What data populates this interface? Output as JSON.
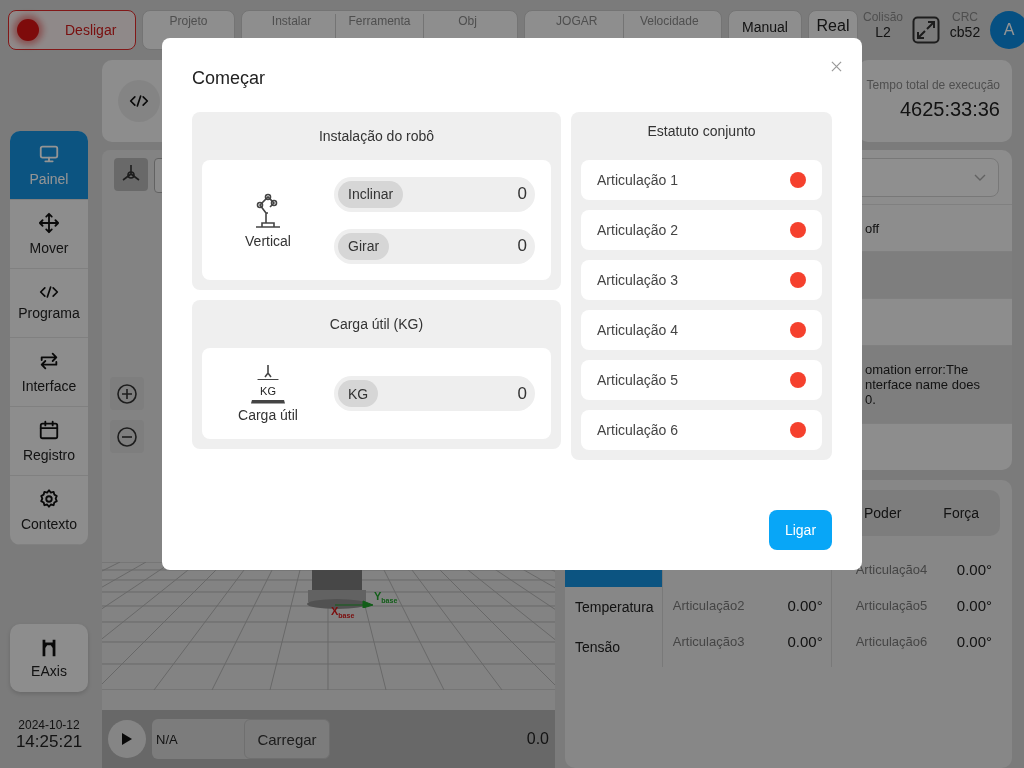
{
  "top_bar": {
    "power_button": {
      "label": "Desligar"
    },
    "groups": [
      [
        {
          "title": "Projeto"
        }
      ],
      [
        {
          "title": "Instalar"
        },
        {
          "title": "Ferramenta"
        },
        {
          "title": "Obj"
        }
      ],
      [
        {
          "title": "JOGAR"
        },
        {
          "title": "Velocidade"
        }
      ]
    ],
    "mode_buttons": [
      "Manual",
      "Real"
    ],
    "collision": {
      "title": "Colisão",
      "value": "L2"
    },
    "crc": {
      "title": "CRC",
      "value": "cb52"
    },
    "avatar": "A"
  },
  "sidebar": {
    "items": [
      {
        "label": "Painel",
        "selected": true
      },
      {
        "label": "Mover",
        "selected": false
      },
      {
        "label": "Programa",
        "selected": false
      },
      {
        "label": "Interface",
        "selected": false
      },
      {
        "label": "Registro",
        "selected": false
      },
      {
        "label": "Contexto",
        "selected": false
      }
    ],
    "extra_button": "EAxis",
    "date": "2024-10-12",
    "time": "14:25:21"
  },
  "runtime": {
    "label": "Tempo total de execução",
    "value": "4625:33:36"
  },
  "viewport": {
    "axis_labels": [
      "X$_{base}$",
      "Y$_{base}$"
    ]
  },
  "playbar": {
    "program": "N/A",
    "load_button": "Carregar",
    "reading": "0.0"
  },
  "status_panel": {
    "rows": [
      {
        "kind": "text",
        "shaded": false,
        "lines": [
          "off"
        ]
      },
      {
        "kind": "blank",
        "shaded": true
      },
      {
        "kind": "blank",
        "shaded": false
      },
      {
        "kind": "text",
        "shaded": true,
        "lines": [
          "omation error:The",
          "nterface name does",
          "0."
        ]
      },
      {
        "kind": "blank",
        "shaded": false
      }
    ]
  },
  "joint_panel": {
    "tabs": [
      "Poder",
      "Força"
    ],
    "side_tabs": [
      {
        "selected": true
      },
      {
        "label": "Temperatura",
        "selected": false
      },
      {
        "label": "Tensão",
        "selected": false
      }
    ],
    "columns": [
      [
        {
          "name": "Articulação2",
          "value": "0.00°"
        },
        {
          "name": "Articulação3",
          "value": "0.00°"
        }
      ],
      [
        {
          "name": "Articulação4",
          "value": "0.00°"
        },
        {
          "name": "Articulação5",
          "value": "0.00°"
        },
        {
          "name": "Articulação6",
          "value": "0.00°"
        }
      ]
    ]
  },
  "dialog": {
    "title": "Começar",
    "installation": {
      "title": "Instalação do robô",
      "mount": "Vertical",
      "fields": [
        {
          "label": "Inclinar",
          "value": "0"
        },
        {
          "label": "Girar",
          "value": "0"
        }
      ]
    },
    "payload": {
      "title": "Carga útil  (KG)",
      "icon_label": "KG",
      "label": "Carga útil",
      "fields": [
        {
          "label": "KG",
          "value": "0"
        }
      ]
    },
    "joints": {
      "title": "Estatuto conjunto",
      "items": [
        {
          "name": "Articulação 1",
          "color": "#f5412e"
        },
        {
          "name": "Articulação 2",
          "color": "#f5412e"
        },
        {
          "name": "Articulação 3",
          "color": "#f5412e"
        },
        {
          "name": "Articulação 4",
          "color": "#f5412e"
        },
        {
          "name": "Articulação 5",
          "color": "#f5412e"
        },
        {
          "name": "Articulação 6",
          "color": "#f5412e"
        }
      ]
    },
    "confirm_button": "Ligar"
  }
}
